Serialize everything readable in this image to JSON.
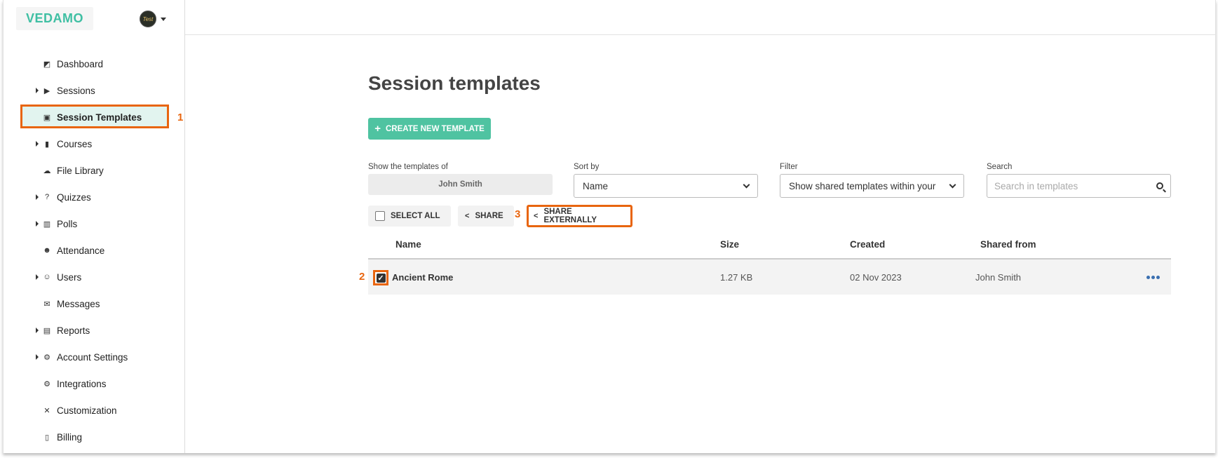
{
  "brand": {
    "logo": "VEDAMO"
  },
  "user": {
    "avatar_initials": "Test"
  },
  "sidebar": {
    "items": [
      {
        "label": "Dashboard",
        "icon": "dashboard-icon",
        "expandable": false
      },
      {
        "label": "Sessions",
        "icon": "play-circle-icon",
        "expandable": true
      },
      {
        "label": "Session Templates",
        "icon": "template-icon",
        "expandable": false,
        "active": true
      },
      {
        "label": "Courses",
        "icon": "book-icon",
        "expandable": true
      },
      {
        "label": "File Library",
        "icon": "cloud-icon",
        "expandable": false
      },
      {
        "label": "Quizzes",
        "icon": "question-icon",
        "expandable": true
      },
      {
        "label": "Polls",
        "icon": "poll-icon",
        "expandable": true
      },
      {
        "label": "Attendance",
        "icon": "attendance-icon",
        "expandable": false
      },
      {
        "label": "Users",
        "icon": "users-icon",
        "expandable": true
      },
      {
        "label": "Messages",
        "icon": "envelope-icon",
        "expandable": false
      },
      {
        "label": "Reports",
        "icon": "report-icon",
        "expandable": true
      },
      {
        "label": "Account Settings",
        "icon": "gear-icon",
        "expandable": true
      },
      {
        "label": "Integrations",
        "icon": "integrations-icon",
        "expandable": false
      },
      {
        "label": "Customization",
        "icon": "tools-icon",
        "expandable": false
      },
      {
        "label": "Billing",
        "icon": "billing-icon",
        "expandable": false
      }
    ]
  },
  "annotations": {
    "step1": "1",
    "step2": "2",
    "step3": "3"
  },
  "main": {
    "title": "Session templates",
    "create_label": "CREATE NEW TEMPLATE",
    "owner_label": "Show the templates of",
    "owner_value": "John Smith",
    "sort_label": "Sort by",
    "sort_value": "Name",
    "filter_label": "Filter",
    "filter_value": "Show shared templates within your",
    "search_label": "Search",
    "search_placeholder": "Search in templates",
    "select_all_label": "SELECT ALL",
    "share_label": "SHARE",
    "share_external_label": "SHARE EXTERNALLY"
  },
  "table": {
    "headers": [
      "Name",
      "Size",
      "Created",
      "Shared from"
    ],
    "rows": [
      {
        "name": "Ancient Rome",
        "size": "1.27 KB",
        "created": "02 Nov 2023",
        "shared_from": "John Smith",
        "checked": true
      }
    ]
  },
  "colors": {
    "accent": "#4fc3a1",
    "highlight": "#e8650f",
    "logo": "#3fbfa3",
    "active_bg": "#e2f4ef",
    "menu_dots": "#3a6fb0"
  }
}
